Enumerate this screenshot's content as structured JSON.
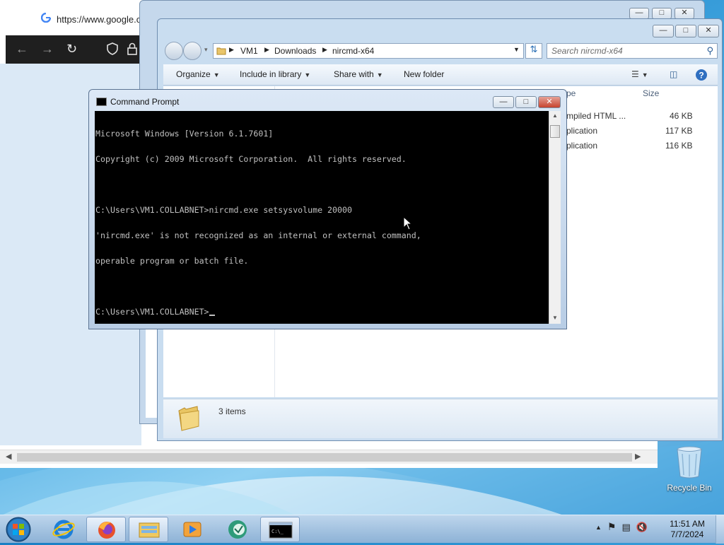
{
  "browser": {
    "url": "https://www.google.c",
    "nav": {
      "back": "←",
      "forward": "→",
      "reload": "↻"
    }
  },
  "explorer": {
    "path": [
      "VM1",
      "Downloads",
      "nircmd-x64"
    ],
    "search_placeholder": "Search nircmd-x64",
    "toolbar": {
      "organize": "Organize",
      "include_in_library": "Include in library",
      "share_with": "Share with",
      "new_folder": "New folder"
    },
    "columns": {
      "type": "pe",
      "size": "Size"
    },
    "files": [
      {
        "type": "mpiled HTML ...",
        "size": "46 KB"
      },
      {
        "type": "plication",
        "size": "117 KB"
      },
      {
        "type": "plication",
        "size": "116 KB"
      }
    ],
    "status": "3 items"
  },
  "cmd": {
    "title": "Command Prompt",
    "lines": [
      "Microsoft Windows [Version 6.1.7601]",
      "Copyright (c) 2009 Microsoft Corporation.  All rights reserved.",
      "",
      "C:\\Users\\VM1.COLLABNET>nircmd.exe setsysvolume 20000",
      "'nircmd.exe' is not recognized as an internal or external command,",
      "operable program or batch file.",
      "",
      "C:\\Users\\VM1.COLLABNET>"
    ]
  },
  "desktop": {
    "recycle_bin": "Recycle Bin"
  },
  "taskbar": {
    "apps": [
      "internet-explorer",
      "firefox",
      "windows-explorer",
      "media-player",
      "chat-app",
      "command-prompt"
    ],
    "time": "11:51 AM",
    "date": "7/7/2024"
  }
}
